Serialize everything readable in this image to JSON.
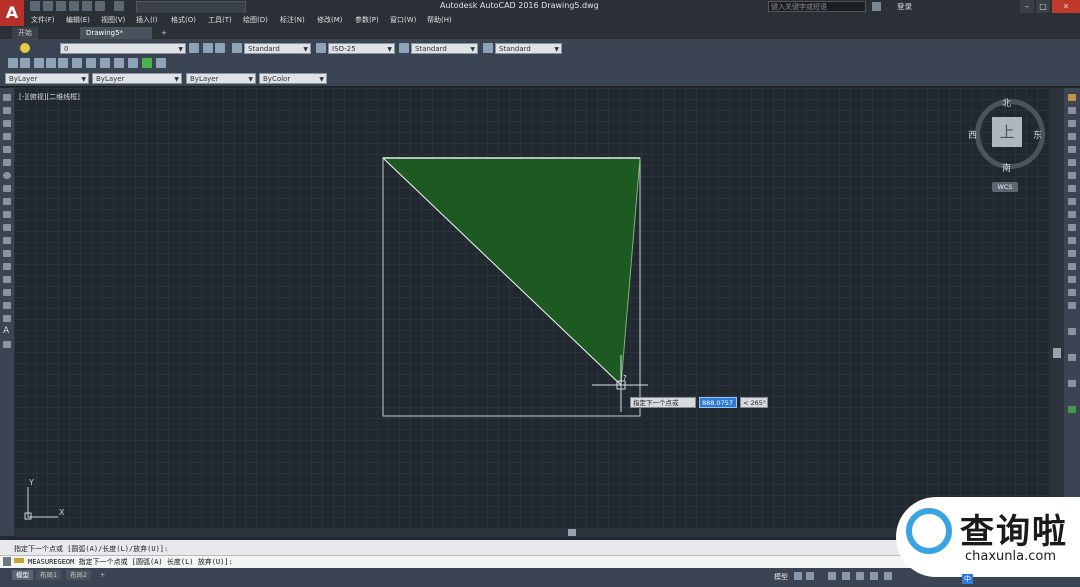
{
  "app": {
    "title": "Autodesk AutoCAD 2016    Drawing5.dwg",
    "search_placeholder": "键入关键字或短语",
    "login": "登录",
    "logo": "A"
  },
  "menu": [
    "文件(F)",
    "编辑(E)",
    "视图(V)",
    "插入(I)",
    "格式(O)",
    "工具(T)",
    "绘图(D)",
    "标注(N)",
    "修改(M)",
    "参数(P)",
    "窗口(W)",
    "帮助(H)"
  ],
  "tabs": {
    "start": "开始",
    "drawing": "Drawing5*",
    "add": "+"
  },
  "toolbar": {
    "layer_value": "0",
    "text_style": "Standard",
    "dim_style": "ISO-25",
    "table_style": "Standard",
    "mleader_style": "Standard",
    "color": "ByLayer",
    "linetype": "ByLayer",
    "lineweight": "ByLayer",
    "plot_style": "ByColor"
  },
  "viewport": {
    "label": "[-][俯视][二维线框]"
  },
  "viewcube": {
    "north": "北",
    "south": "南",
    "east": "东",
    "west": "西",
    "top": "上",
    "wcs": "WCS"
  },
  "prompt": {
    "text": "指定下一个点或",
    "value": "888.0757",
    "angle": "< 265°",
    "cursor_mark": "?"
  },
  "ucs": {
    "x": "X",
    "y": "Y"
  },
  "command": {
    "history": "指定下一个点或 [圆弧(A)/长度(L)/放弃(U)]:",
    "current": "MEASUREGEOM 指定下一个点或 [圆弧(A) 长度(L) 放弃(U)]:"
  },
  "status": {
    "layout_tabs": [
      "模型",
      "布局1",
      "布局2"
    ],
    "add_layout": "+",
    "model": "模型",
    "ime": "中"
  },
  "watermark": {
    "title": "查询啦",
    "url": "chaxunla.com"
  },
  "colors": {
    "fill": "#1d5a22",
    "background": "#212830",
    "accent_blue": "#2d7bd6"
  }
}
